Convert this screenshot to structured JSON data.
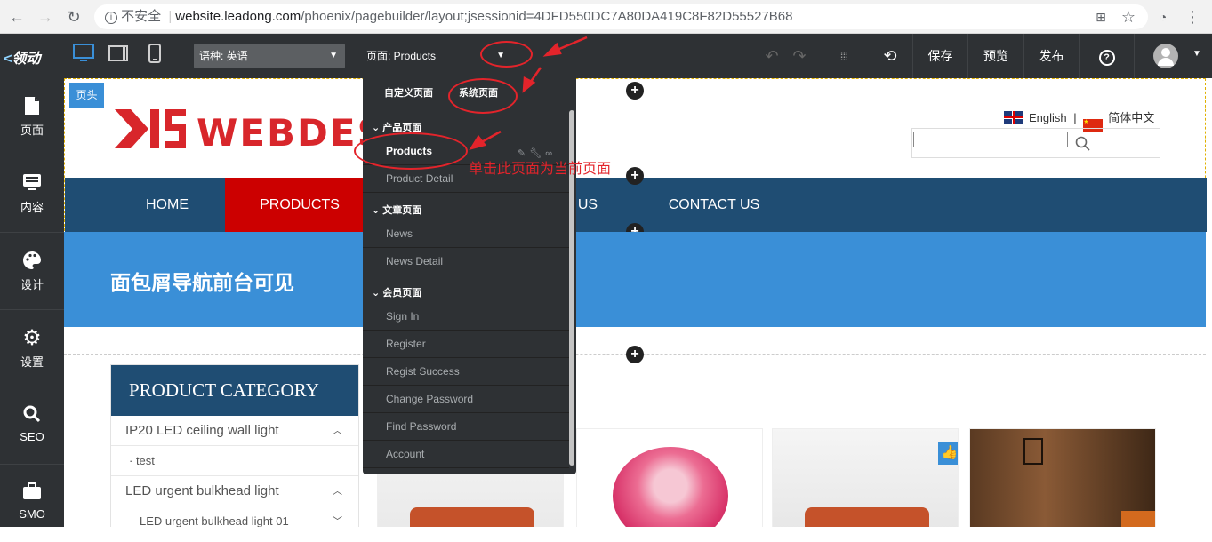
{
  "browser": {
    "security_label": "不安全",
    "url_host": "website.leadong.com",
    "url_path": "/phoenix/pagebuilder/layout;jsessionid=4DFD550DC7A80DA419C8F82D55527B68"
  },
  "toolbar": {
    "brand": "领动",
    "language_label": "语种:  英语",
    "page_label": "页面:  Products",
    "save": "保存",
    "preview": "预览",
    "publish": "发布"
  },
  "sidebar": {
    "items": [
      {
        "label": "页面",
        "icon": "page-icon"
      },
      {
        "label": "内容",
        "icon": "content-icon"
      },
      {
        "label": "设计",
        "icon": "palette-icon"
      },
      {
        "label": "设置",
        "icon": "gear-icon"
      },
      {
        "label": "SEO",
        "icon": "search-icon"
      },
      {
        "label": "SMO",
        "icon": "briefcase-icon"
      }
    ]
  },
  "site": {
    "header_tag": "页头",
    "logo_text": "WEBDESI",
    "lang_en": "English",
    "lang_sep": "|",
    "lang_zh": "简体中文",
    "nav": [
      "HOME",
      "PRODUCTS",
      "US",
      "CONTACT US"
    ],
    "banner_title": "面包屑导航前台可见",
    "category": {
      "title": "PRODUCT CATEGORY",
      "rows": [
        {
          "label": "IP20 LED ceiling wall light",
          "chev": "^"
        },
        {
          "label": "· test",
          "chev": ""
        },
        {
          "label": "LED urgent bulkhead light",
          "chev": "^"
        },
        {
          "label": "LED urgent bulkhead light 01",
          "chev": "v"
        }
      ]
    }
  },
  "dropdown": {
    "tabs": [
      "自定义页面",
      "系统页面"
    ],
    "groups": [
      {
        "title": "产品页面",
        "items": [
          "Products",
          "Product Detail"
        ]
      },
      {
        "title": "文章页面",
        "items": [
          "News",
          "News Detail"
        ]
      },
      {
        "title": "会员页面",
        "items": [
          "Sign In",
          "Register",
          "Regist Success",
          "Change Password",
          "Find Password",
          "Account"
        ]
      }
    ]
  },
  "annotation": {
    "note": "单击此页面为当前页面",
    "color": "#e3242b"
  },
  "colors": {
    "toolbar_bg": "#2e3134",
    "accent_blue": "#3a8fd7",
    "nav_bg": "#1f4d73",
    "nav_active": "#cc0000",
    "brand_red": "#d8262b"
  }
}
